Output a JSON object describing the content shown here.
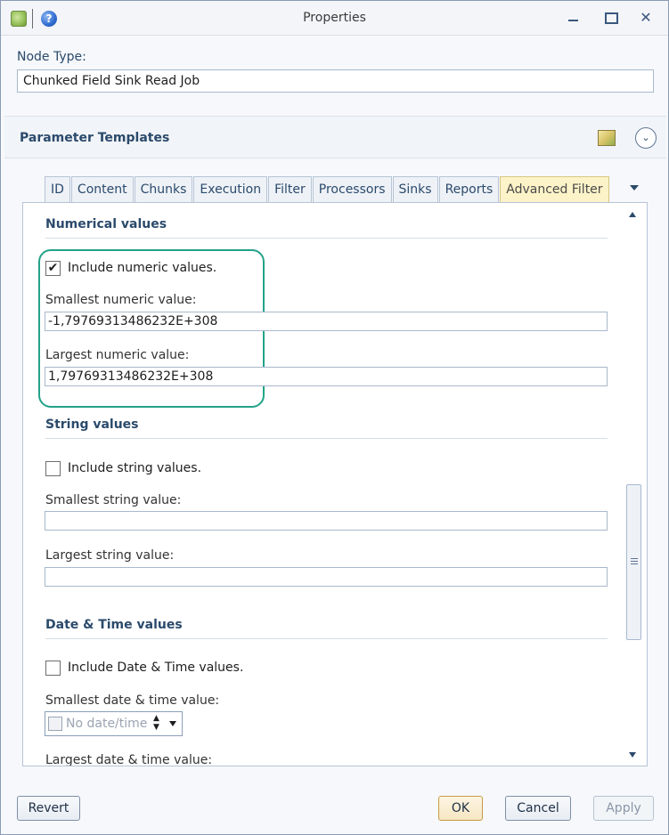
{
  "window": {
    "title": "Properties",
    "icons": [
      "app-icon",
      "help-icon"
    ],
    "controls": [
      "minimize-icon",
      "maximize-icon",
      "close-icon"
    ],
    "close_glyph": "✕"
  },
  "node_type": {
    "label": "Node Type:",
    "value": "Chunked Field Sink Read Job"
  },
  "parameter_templates": {
    "title": "Parameter Templates",
    "icons": [
      "package-icon",
      "chevron-down-icon"
    ]
  },
  "tabs": [
    {
      "label": "ID"
    },
    {
      "label": "Content"
    },
    {
      "label": "Chunks"
    },
    {
      "label": "Execution"
    },
    {
      "label": "Filter"
    },
    {
      "label": "Processors"
    },
    {
      "label": "Sinks"
    },
    {
      "label": "Reports"
    },
    {
      "label": "Advanced Filter",
      "active": true
    }
  ],
  "numerical": {
    "title": "Numerical values",
    "include_label": "Include numeric values.",
    "include_checked": true,
    "smallest_label": "Smallest numeric value:",
    "smallest_value": "-1,79769313486232E+308",
    "largest_label": "Largest numeric value:",
    "largest_value": "1,79769313486232E+308"
  },
  "string": {
    "title": "String values",
    "include_label": "Include string values.",
    "include_checked": false,
    "smallest_label": "Smallest string value:",
    "smallest_value": "",
    "largest_label": "Largest string value:",
    "largest_value": ""
  },
  "datetime": {
    "title": "Date & Time values",
    "include_label": "Include Date & Time values.",
    "include_checked": false,
    "smallest_label": "Smallest date & time value:",
    "smallest_value": "No date/time",
    "largest_label": "Largest date & time value:"
  },
  "buttons": {
    "revert": "Revert",
    "ok": "OK",
    "cancel": "Cancel",
    "apply": "Apply",
    "apply_enabled": false
  },
  "colors": {
    "highlight_border": "#23a389",
    "active_tab": "#fdf3c8",
    "heading_text": "#2b4a6b"
  }
}
